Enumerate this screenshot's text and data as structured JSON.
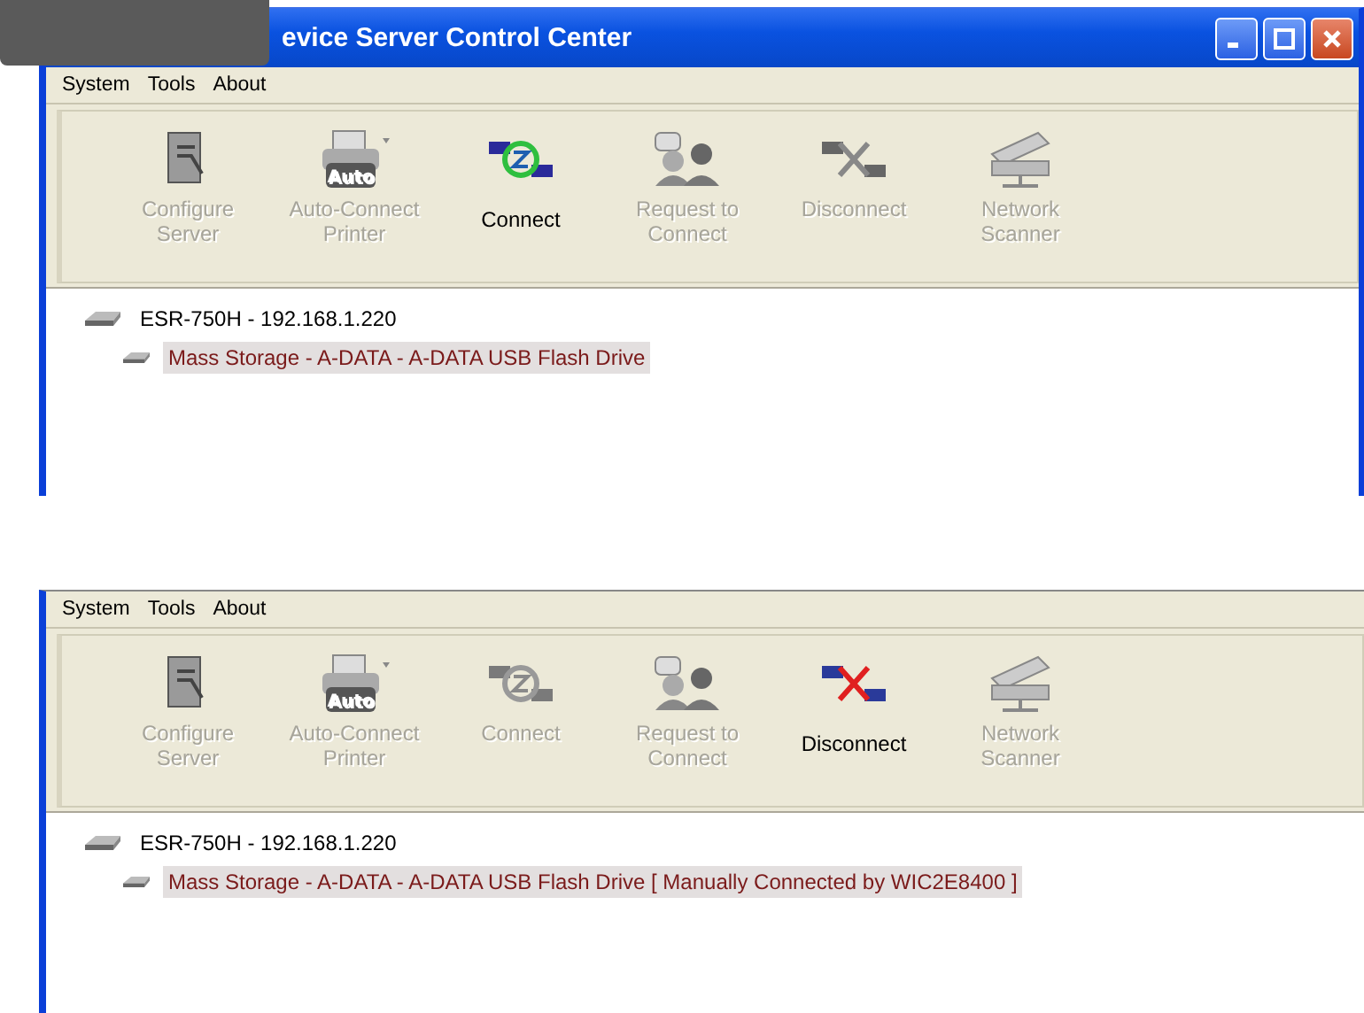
{
  "panels": [
    {
      "title": "evice Server Control Center",
      "menu": [
        "System",
        "Tools",
        "About"
      ],
      "toolbar": [
        {
          "kind": "configure",
          "label": "Configure Server",
          "disabled": true
        },
        {
          "kind": "printer",
          "label": "Auto-Connect Printer",
          "disabled": true,
          "badge": "Auto"
        },
        {
          "kind": "connect",
          "label": "Connect",
          "disabled": false
        },
        {
          "kind": "request",
          "label": "Request to Connect",
          "disabled": true
        },
        {
          "kind": "disconnect",
          "label": "Disconnect",
          "disabled": true
        },
        {
          "kind": "scanner",
          "label": "Network Scanner",
          "disabled": true
        }
      ],
      "tree": [
        {
          "label": "ESR-750H - 192.168.1.220",
          "selected": false,
          "children": [
            {
              "label": "Mass Storage - A-DATA - A-DATA USB Flash Drive",
              "selected": true
            }
          ]
        }
      ]
    },
    {
      "menu": [
        "System",
        "Tools",
        "About"
      ],
      "toolbar": [
        {
          "kind": "configure",
          "label": "Configure Server",
          "disabled": true
        },
        {
          "kind": "printer",
          "label": "Auto-Connect Printer",
          "disabled": true,
          "badge": "Auto"
        },
        {
          "kind": "connect",
          "label": "Connect",
          "disabled": true
        },
        {
          "kind": "request",
          "label": "Request to Connect",
          "disabled": true
        },
        {
          "kind": "disconnect",
          "label": "Disconnect",
          "disabled": false
        },
        {
          "kind": "scanner",
          "label": "Network Scanner",
          "disabled": true
        }
      ],
      "tree": [
        {
          "label": "ESR-750H - 192.168.1.220",
          "selected": false,
          "children": [
            {
              "label": "Mass Storage - A-DATA - A-DATA USB Flash Drive [ Manually Connected by WIC2E8400 ]",
              "selected": true
            }
          ]
        }
      ]
    }
  ]
}
